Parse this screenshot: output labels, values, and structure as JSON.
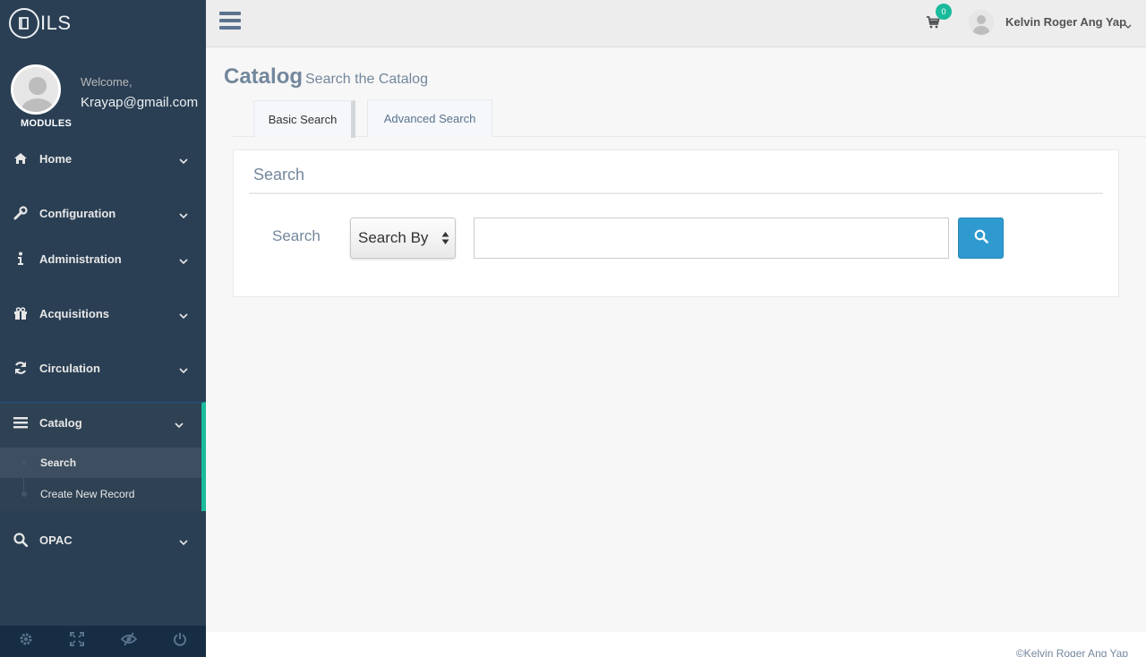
{
  "brand": {
    "name": "ILS"
  },
  "profile": {
    "welcome": "Welcome,",
    "email": "Krayap@gmail.com",
    "section_label": "MODULES"
  },
  "menu": [
    {
      "label": "Home",
      "icon": "home-icon"
    },
    {
      "label": "Configuration",
      "icon": "wrench-icon"
    },
    {
      "label": "Administration",
      "icon": "info-icon"
    },
    {
      "label": "Acquisitions",
      "icon": "gift-icon"
    },
    {
      "label": "Circulation",
      "icon": "refresh-icon"
    },
    {
      "label": "Catalog",
      "icon": "bars-icon",
      "expanded": true,
      "children": [
        {
          "label": "Search",
          "active": true
        },
        {
          "label": "Create New Record"
        }
      ]
    },
    {
      "label": "OPAC",
      "icon": "search-icon"
    }
  ],
  "sidebar_footer": [
    "settings-icon",
    "fullscreen-icon",
    "eye-slash-icon",
    "power-icon"
  ],
  "topnav": {
    "cart_count": "0",
    "user_name": "Kelvin Roger Ang Yap"
  },
  "page": {
    "title": "Catalog",
    "subtitle": "Search the Catalog"
  },
  "tabs": [
    {
      "label": "Basic Search",
      "active": true
    },
    {
      "label": "Advanced Search",
      "active": false
    }
  ],
  "panel": {
    "title": "Search",
    "field_label": "Search",
    "select_value": "Search By",
    "input_value": "",
    "button_icon": "search-icon"
  },
  "footer": {
    "text": "©Kelvin Roger Ang Yap"
  },
  "colors": {
    "sidebar": "#2a3f54",
    "accent": "#1abb9c",
    "button": "#2e9ad0",
    "text": "#73879c"
  }
}
